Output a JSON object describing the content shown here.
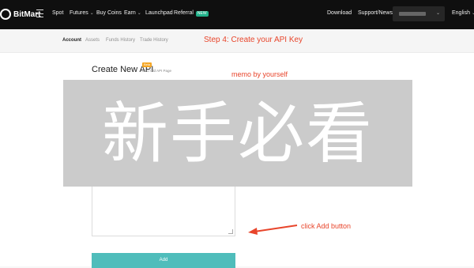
{
  "topbar": {
    "logo_text": "BitMart",
    "nav": [
      {
        "label": "Spot"
      },
      {
        "label": "Futures",
        "has_dropdown": true
      },
      {
        "label": "Buy Coins"
      },
      {
        "label": "Earn",
        "has_dropdown": true
      },
      {
        "label": "Launchpad"
      },
      {
        "label": "Referral",
        "badge": "NEW"
      }
    ],
    "right": {
      "download": "Download",
      "support": "Support/News",
      "language": "English"
    }
  },
  "subtabs": [
    "Account",
    "Assets",
    "Funds History",
    "Trade History"
  ],
  "annotations": {
    "step": "Step 4: Create your API Key",
    "memo": "memo by yourself",
    "add": "click Add button"
  },
  "form": {
    "title": "Create New API",
    "title_badge": "Beta",
    "old_link": "Goto Old API Page",
    "add_button": "Add"
  },
  "overlay": {
    "text": "新手必看"
  },
  "colors": {
    "topbar_bg": "#0f0f0f",
    "annotation_red": "#e8452b",
    "add_button": "#4fbdbb",
    "overlay_bg": "#cbcbcb"
  }
}
